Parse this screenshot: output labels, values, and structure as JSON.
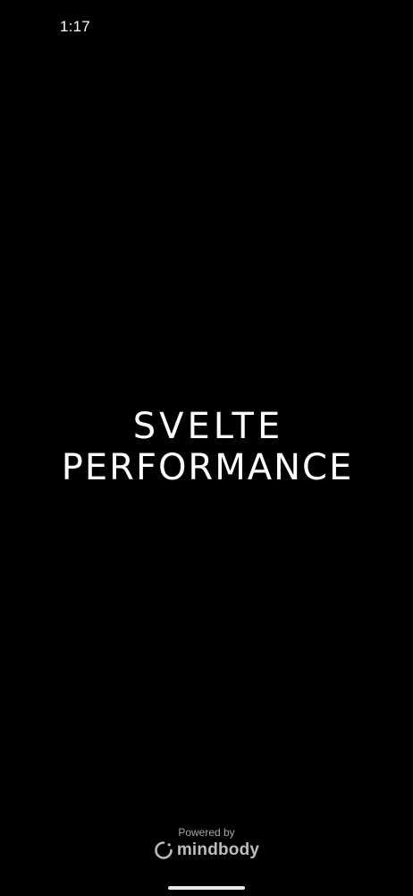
{
  "status_bar": {
    "time": "1:17"
  },
  "splash": {
    "logo_line_1": "SVELTE",
    "logo_line_2": "PERFORMANCE",
    "background_color": "#000000",
    "text_color": "#ffffff"
  },
  "footer": {
    "powered_by": "Powered by",
    "brand": "mindbody",
    "brand_icon": "mindbody-logo-icon",
    "brand_color": "#bdbdbd"
  }
}
